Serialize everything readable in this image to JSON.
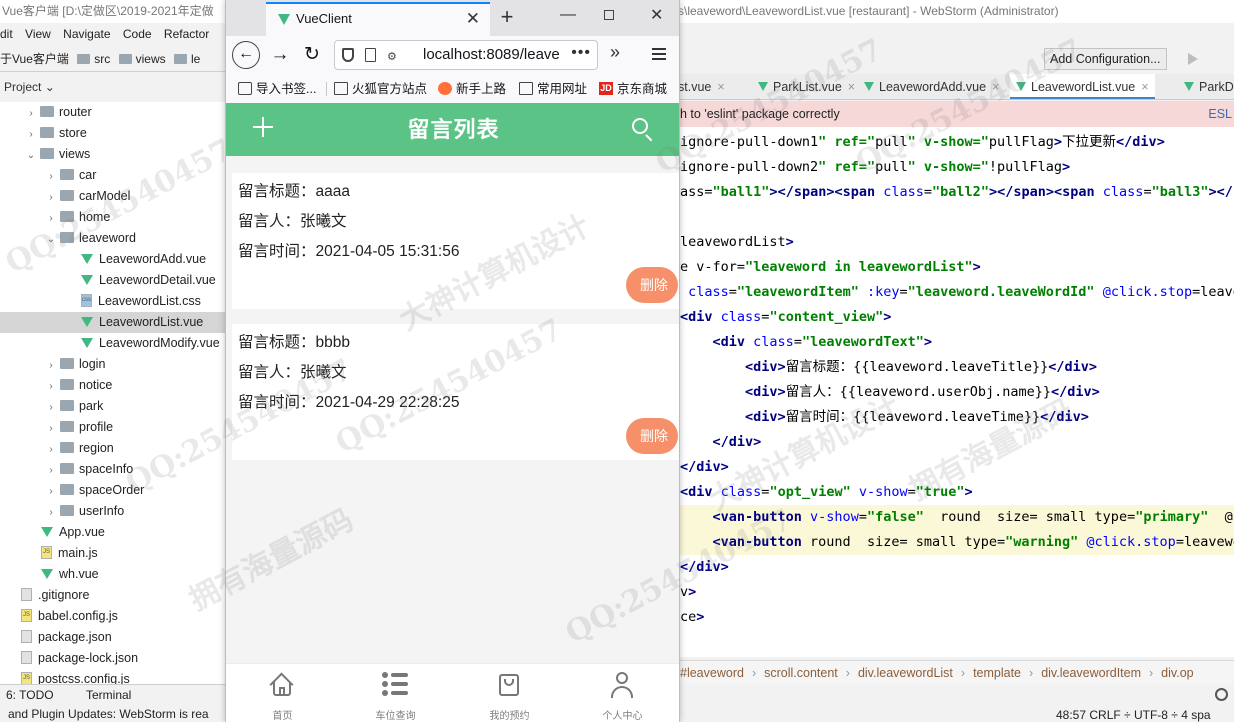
{
  "ide": {
    "title_left": "Vue客户端 [D:\\定做区\\2019-2021年定做",
    "title_right": "s\\leaveword\\LeavewordList.vue [restaurant] - WebStorm (Administrator)",
    "menu": [
      "dit",
      "View",
      "Navigate",
      "Code",
      "Refactor"
    ],
    "nav_crumbs": [
      "于Vue客户端",
      "src",
      "views",
      "le"
    ],
    "project_label": "Project",
    "tree": [
      {
        "label": "router",
        "type": "folder",
        "indent": 1,
        "arrow": "›"
      },
      {
        "label": "store",
        "type": "folder",
        "indent": 1,
        "arrow": "›"
      },
      {
        "label": "views",
        "type": "folder",
        "indent": 1,
        "arrow": "⌄"
      },
      {
        "label": "car",
        "type": "folder",
        "indent": 2,
        "arrow": "›"
      },
      {
        "label": "carModel",
        "type": "folder",
        "indent": 2,
        "arrow": "›"
      },
      {
        "label": "home",
        "type": "folder",
        "indent": 2,
        "arrow": "›"
      },
      {
        "label": "leaveword",
        "type": "folder",
        "indent": 2,
        "arrow": "⌄"
      },
      {
        "label": "LeavewordAdd.vue",
        "type": "vue",
        "indent": 3,
        "arrow": ""
      },
      {
        "label": "LeavewordDetail.vue",
        "type": "vue",
        "indent": 3,
        "arrow": ""
      },
      {
        "label": "LeavewordList.css",
        "type": "css",
        "indent": 3,
        "arrow": ""
      },
      {
        "label": "LeavewordList.vue",
        "type": "vue",
        "indent": 3,
        "arrow": "",
        "selected": true
      },
      {
        "label": "LeavewordModify.vue",
        "type": "vue",
        "indent": 3,
        "arrow": ""
      },
      {
        "label": "login",
        "type": "folder",
        "indent": 2,
        "arrow": "›"
      },
      {
        "label": "notice",
        "type": "folder",
        "indent": 2,
        "arrow": "›"
      },
      {
        "label": "park",
        "type": "folder",
        "indent": 2,
        "arrow": "›"
      },
      {
        "label": "profile",
        "type": "folder",
        "indent": 2,
        "arrow": "›"
      },
      {
        "label": "region",
        "type": "folder",
        "indent": 2,
        "arrow": "›"
      },
      {
        "label": "spaceInfo",
        "type": "folder",
        "indent": 2,
        "arrow": "›"
      },
      {
        "label": "spaceOrder",
        "type": "folder",
        "indent": 2,
        "arrow": "›"
      },
      {
        "label": "userInfo",
        "type": "folder",
        "indent": 2,
        "arrow": "›"
      },
      {
        "label": "App.vue",
        "type": "vue",
        "indent": 1,
        "arrow": ""
      },
      {
        "label": "main.js",
        "type": "js",
        "indent": 1,
        "arrow": ""
      },
      {
        "label": "wh.vue",
        "type": "vue",
        "indent": 1,
        "arrow": ""
      },
      {
        "label": ".gitignore",
        "type": "file",
        "indent": 0,
        "arrow": ""
      },
      {
        "label": "babel.config.js",
        "type": "js",
        "indent": 0,
        "arrow": ""
      },
      {
        "label": "package.json",
        "type": "file",
        "indent": 0,
        "arrow": ""
      },
      {
        "label": "package-lock.json",
        "type": "file",
        "indent": 0,
        "arrow": ""
      },
      {
        "label": "postcss.config.js",
        "type": "js",
        "indent": 0,
        "arrow": ""
      }
    ],
    "bottom_tools": [
      "6: TODO",
      "Terminal"
    ],
    "status_left": "and Plugin Updates: WebStorm is rea",
    "add_config_label": "Add Configuration...",
    "tabs": [
      "st.vue",
      "ParkList.vue",
      "LeavewordAdd.vue",
      "LeavewordList.vue",
      "ParkDet"
    ],
    "active_tab": "LeavewordList.vue",
    "warning": "h to 'eslint' package correctly",
    "warning_link": "ESL",
    "crumbs": [
      "#leaveword",
      "scroll.content",
      "div.leavewordList",
      "template",
      "div.leavewordItem",
      "div.op"
    ],
    "status_pos": "48:57  CRLF ÷  UTF-8 ÷  4 spa",
    "code_lines": [
      "ignore-pull-down1\" ref=\"pull\" v-show=\"pullFlag\">下拉更新</div>",
      "ignore-pull-down2\" ref=\"pull\" v-show=\"!pullFlag\">",
      "ass=\"ball1\"></span><span class=\"ball2\"></span><span class=\"ball3\"></sp",
      "",
      "leavewordList\">",
      "e v-for=\"leaveword in leavewordList\">",
      " class=\"leavewordItem\" :key=\"leaveword.leaveWordId\" @click.stop=\"leave",
      "<div class=\"content_view\">",
      "    <div class=\"leavewordText\">",
      "        <div>留言标题：{{leaveword.leaveTitle}}</div>",
      "        <div>留言人：{{leaveword.userObj.name}}</div>",
      "        <div>留言时间：{{leaveword.leaveTime}}</div>",
      "    </div>",
      "</div>",
      "<div class=\"opt_view\" v-show=\"true\">",
      "    <van-button v-show=\"false\"  round  size= small type=\"primary\"  @cl",
      "    <van-button round  size= small type=\"warning\" @click.stop=\"leavewo",
      "</div>",
      "v>",
      "ce>"
    ]
  },
  "browser": {
    "tab_title": "VueClient",
    "url": "localhost:8089/leave",
    "bookmarks": [
      "导入书签...",
      "火狐官方站点",
      "新手上路",
      "常用网址",
      "京东商城"
    ]
  },
  "app": {
    "header_title": "留言列表",
    "header_color": "#5bc386",
    "delete_color": "#f6906a",
    "items": [
      {
        "title_label": "留言标题：",
        "title": "aaaa",
        "user_label": "留言人：",
        "user": "张曦文",
        "time_label": "留言时间：",
        "time": "2021-04-05 15:31:56",
        "delete": "删除"
      },
      {
        "title_label": "留言标题：",
        "title": "bbbb",
        "user_label": "留言人：",
        "user": "张曦文",
        "time_label": "留言时间：",
        "time": "2021-04-29 22:28:25",
        "delete": "删除"
      }
    ],
    "tabbar": [
      {
        "label": "首页",
        "icon": "home-icon"
      },
      {
        "label": "车位查询",
        "icon": "list-icon"
      },
      {
        "label": "我的预约",
        "icon": "bag-icon"
      },
      {
        "label": "个人中心",
        "icon": "user-icon"
      }
    ]
  },
  "watermarks": [
    "QQ:254540457",
    "大神计算机设计",
    "拥有海量源码"
  ]
}
